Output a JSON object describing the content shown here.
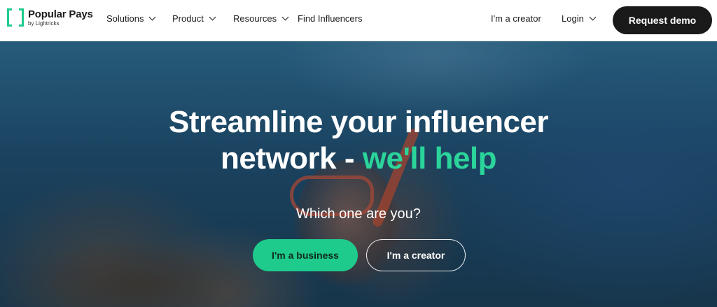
{
  "brand": {
    "name": "Popular Pays",
    "sub": "by Lightricks",
    "accent": "#1ecb8c"
  },
  "nav": {
    "solutions": "Solutions",
    "product": "Product",
    "resources": "Resources",
    "find": "Find Influencers",
    "creator": "I'm a creator",
    "login": "Login",
    "demo": "Request demo"
  },
  "hero": {
    "headline_line1": "Streamline your influencer",
    "headline_line2_start": "network - ",
    "headline_line2_accent": "we'll help",
    "question": "Which one are you?",
    "btn_business": "I'm a business",
    "btn_creator": "I'm a creator"
  }
}
